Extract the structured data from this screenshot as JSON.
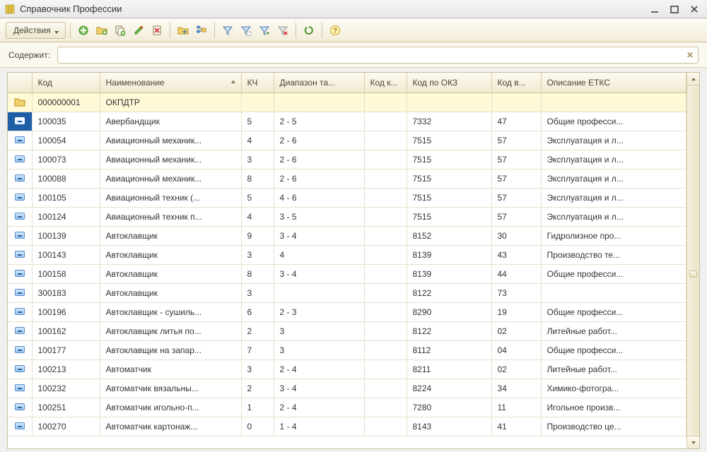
{
  "window": {
    "title": "Справочник Профессии"
  },
  "toolbar": {
    "actions_label": "Действия"
  },
  "search": {
    "label": "Содержит:",
    "value": "",
    "placeholder": ""
  },
  "columns": {
    "code": "Код",
    "name": "Наименование",
    "kch": "КЧ",
    "range": "Диапазон та...",
    "kodk": "Код к...",
    "okz": "Код по ОКЗ",
    "kodv": "Код в...",
    "desc": "Описание ЕТКС"
  },
  "sorted_column": "name",
  "rows": [
    {
      "type": "folder",
      "code": "000000001",
      "name": "ОКПДТР",
      "kch": "",
      "range": "",
      "kodk": "",
      "okz": "",
      "kodv": "",
      "desc": ""
    },
    {
      "type": "item",
      "selected": true,
      "code": "100035",
      "name": "Авербандщик",
      "kch": "5",
      "range": "2 - 5",
      "kodk": "",
      "okz": "7332",
      "kodv": "47",
      "desc": "Общие професси..."
    },
    {
      "type": "item",
      "code": "100054",
      "name": "Авиационный механик...",
      "kch": "4",
      "range": "2 - 6",
      "kodk": "",
      "okz": "7515",
      "kodv": "57",
      "desc": "Эксплуатация и л..."
    },
    {
      "type": "item",
      "code": "100073",
      "name": "Авиационный механик...",
      "kch": "3",
      "range": "2 - 6",
      "kodk": "",
      "okz": "7515",
      "kodv": "57",
      "desc": "Эксплуатация и л..."
    },
    {
      "type": "item",
      "code": "100088",
      "name": "Авиационный механик...",
      "kch": "8",
      "range": "2 - 6",
      "kodk": "",
      "okz": "7515",
      "kodv": "57",
      "desc": "Эксплуатация и л..."
    },
    {
      "type": "item",
      "code": "100105",
      "name": "Авиационный техник (...",
      "kch": "5",
      "range": "4 - 6",
      "kodk": "",
      "okz": "7515",
      "kodv": "57",
      "desc": "Эксплуатация и л..."
    },
    {
      "type": "item",
      "code": "100124",
      "name": "Авиационный техник п...",
      "kch": "4",
      "range": "3 - 5",
      "kodk": "",
      "okz": "7515",
      "kodv": "57",
      "desc": "Эксплуатация и л..."
    },
    {
      "type": "item",
      "code": "100139",
      "name": "Автоклавщик",
      "kch": "9",
      "range": "3 - 4",
      "kodk": "",
      "okz": "8152",
      "kodv": "30",
      "desc": "Гидролизное про..."
    },
    {
      "type": "item",
      "code": "100143",
      "name": "Автоклавщик",
      "kch": "3",
      "range": "4",
      "kodk": "",
      "okz": "8139",
      "kodv": "43",
      "desc": "Производство те..."
    },
    {
      "type": "item",
      "code": "100158",
      "name": "Автоклавщик",
      "kch": "8",
      "range": "3 - 4",
      "kodk": "",
      "okz": "8139",
      "kodv": "44",
      "desc": "Общие професси..."
    },
    {
      "type": "item",
      "code": "300183",
      "name": "Автоклавщик",
      "kch": "3",
      "range": "",
      "kodk": "",
      "okz": "8122",
      "kodv": "73",
      "desc": ""
    },
    {
      "type": "item",
      "code": "100196",
      "name": "Автоклавщик - сушиль...",
      "kch": "6",
      "range": "2 - 3",
      "kodk": "",
      "okz": "8290",
      "kodv": "19",
      "desc": "Общие професси..."
    },
    {
      "type": "item",
      "code": "100162",
      "name": "Автоклавщик литья по...",
      "kch": "2",
      "range": "3",
      "kodk": "",
      "okz": "8122",
      "kodv": "02",
      "desc": "Литейные работ..."
    },
    {
      "type": "item",
      "code": "100177",
      "name": "Автоклавщик на запар...",
      "kch": "7",
      "range": "3",
      "kodk": "",
      "okz": "8112",
      "kodv": "04",
      "desc": "Общие професси..."
    },
    {
      "type": "item",
      "code": "100213",
      "name": "Автоматчик",
      "kch": "3",
      "range": "2 - 4",
      "kodk": "",
      "okz": "8211",
      "kodv": "02",
      "desc": "Литейные работ..."
    },
    {
      "type": "item",
      "code": "100232",
      "name": "Автоматчик вязальны...",
      "kch": "2",
      "range": "3 - 4",
      "kodk": "",
      "okz": "8224",
      "kodv": "34",
      "desc": "Химико-фотогра..."
    },
    {
      "type": "item",
      "code": "100251",
      "name": "Автоматчик игольно-п...",
      "kch": "1",
      "range": "2 - 4",
      "kodk": "",
      "okz": "7280",
      "kodv": "11",
      "desc": "Игольное произв..."
    },
    {
      "type": "item",
      "code": "100270",
      "name": "Автоматчик картонаж...",
      "kch": "0",
      "range": "1 - 4",
      "kodk": "",
      "okz": "8143",
      "kodv": "41",
      "desc": "Производство це..."
    }
  ]
}
